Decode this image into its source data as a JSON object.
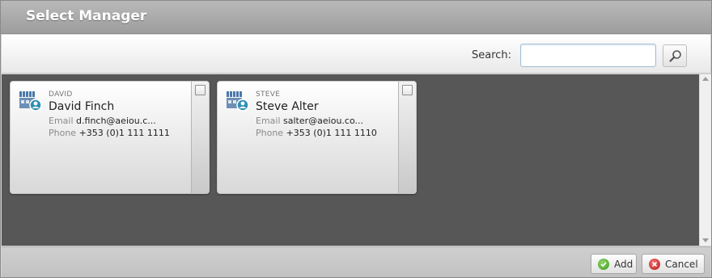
{
  "dialog": {
    "title": "Select Manager"
  },
  "search": {
    "label": "Search:",
    "value": "",
    "placeholder": ""
  },
  "managers": [
    {
      "code": "DAVID",
      "name": "David Finch",
      "email_label": "Email",
      "email": "d.finch@aeiou.c...",
      "phone_label": "Phone",
      "phone": "+353 (0)1 111 1111",
      "selected": false
    },
    {
      "code": "STEVE",
      "name": "Steve Alter",
      "email_label": "Email",
      "email": "salter@aeiou.co...",
      "phone_label": "Phone",
      "phone": "+353 (0)1 111 1110",
      "selected": false
    }
  ],
  "footer": {
    "add_label": "Add",
    "cancel_label": "Cancel"
  },
  "icons": {
    "search_button": "magnifier-icon",
    "manager_avatar": "manager-avatar-icon",
    "add": "check-circle-icon",
    "cancel": "close-circle-icon"
  },
  "colors": {
    "add_icon": "#4caf2a",
    "cancel_icon": "#c62828",
    "content_bg": "#575757",
    "search_border": "#9fbfd8"
  }
}
